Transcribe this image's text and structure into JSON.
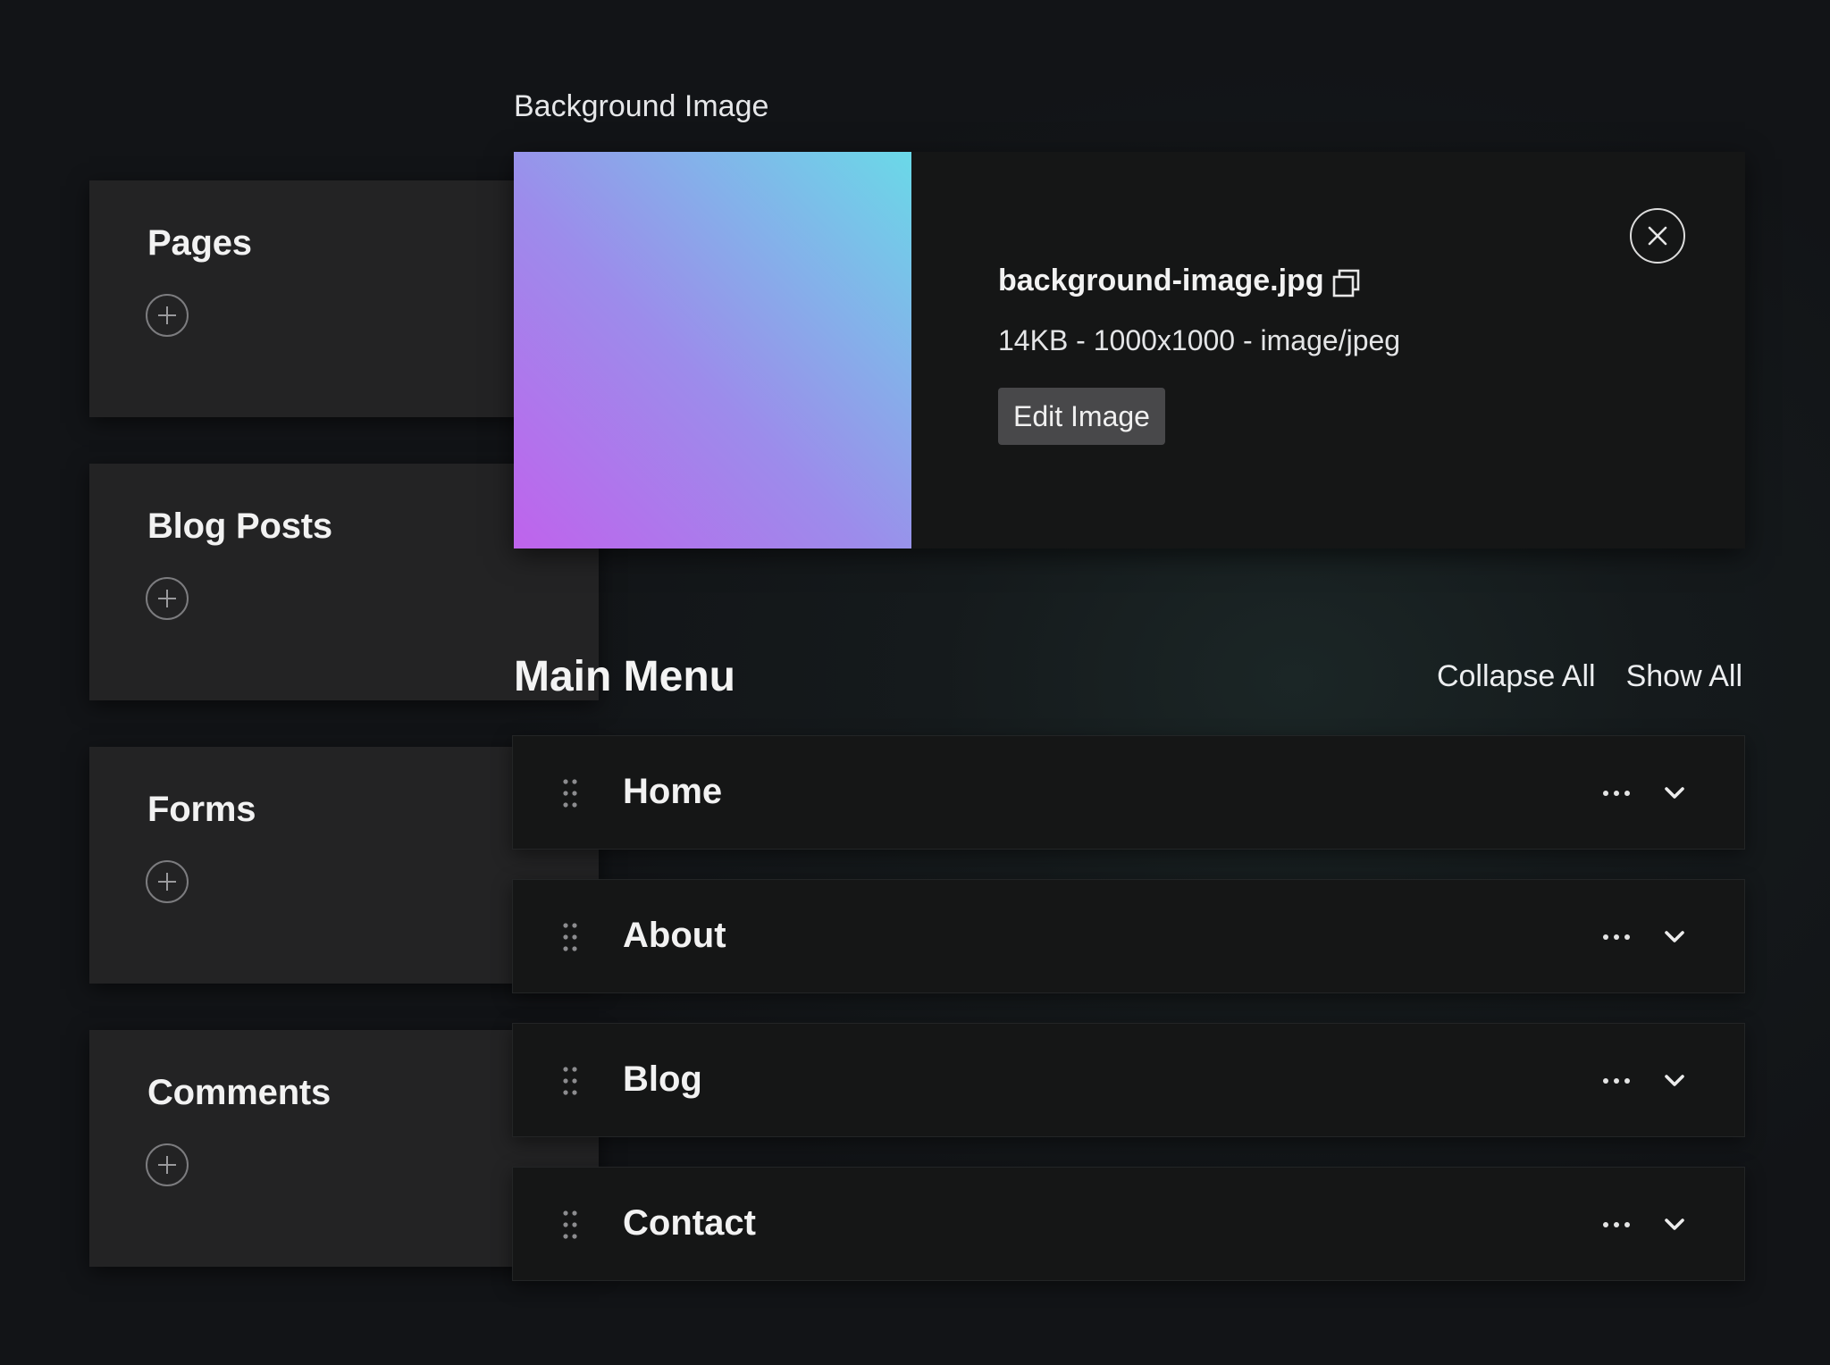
{
  "collections": [
    {
      "title": "Pages"
    },
    {
      "title": "Blog Posts"
    },
    {
      "title": "Forms"
    },
    {
      "title": "Comments"
    }
  ],
  "background_image": {
    "section_label": "Background Image",
    "file_name": "background-image.jpg",
    "file_meta": "14KB - 1000x1000 - image/jpeg",
    "edit_label": "Edit Image",
    "gradient_colors": [
      "#bf63ec",
      "#9c8ceb",
      "#6ad9e8"
    ]
  },
  "main_menu": {
    "title": "Main Menu",
    "collapse_all": "Collapse All",
    "show_all": "Show All",
    "items": [
      {
        "label": "Home"
      },
      {
        "label": "About"
      },
      {
        "label": "Blog"
      },
      {
        "label": "Contact"
      }
    ]
  },
  "icons": {
    "add": "plus-circle-icon",
    "copy": "copy-icon",
    "close": "close-circle-icon",
    "drag": "drag-handle-icon",
    "more": "more-horizontal-icon",
    "expand": "chevron-down-icon"
  }
}
